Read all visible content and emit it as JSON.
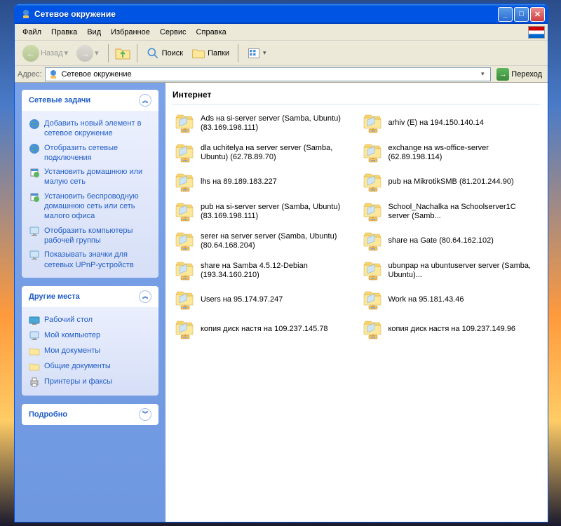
{
  "window": {
    "title": "Сетевое окружение"
  },
  "menubar": {
    "file": "Файл",
    "edit": "Правка",
    "view": "Вид",
    "favorites": "Избранное",
    "tools": "Сервис",
    "help": "Справка"
  },
  "toolbar": {
    "back": "Назад",
    "search": "Поиск",
    "folders": "Папки"
  },
  "addressbar": {
    "label": "Адрес:",
    "value": "Сетевое окружение",
    "go": "Переход"
  },
  "sidebar": {
    "panel1": {
      "title": "Сетевые задачи",
      "items": [
        "Добавить новый элемент в сетевое окружение",
        "Отобразить сетевые подключения",
        "Установить домашнюю или малую сеть",
        "Установить беспроводную домашнюю сеть или сеть малого офиса",
        "Отобразить компьютеры рабочей группы",
        "Показывать значки для сетевых UPnP-устройств"
      ]
    },
    "panel2": {
      "title": "Другие места",
      "items": [
        "Рабочий стол",
        "Мой компьютер",
        "Мои документы",
        "Общие документы",
        "Принтеры и факсы"
      ]
    },
    "panel3": {
      "title": "Подробно"
    }
  },
  "main": {
    "heading": "Интернет",
    "items": [
      "Ads на si-server server (Samba, Ubuntu) (83.169.198.111)",
      "arhiv (E) на 194.150.140.14",
      "dla uchitelya на server server (Samba, Ubuntu) (62.78.89.70)",
      "exchange на ws-office-server (62.89.198.114)",
      "lhs на 89.189.183.227",
      "pub на MikrotikSMB (81.201.244.90)",
      "pub на si-server server (Samba, Ubuntu) (83.169.198.111)",
      "School_Nachalka на Schoolserver1C server (Samb...",
      "serer на server server (Samba, Ubuntu) (80.64.168.204)",
      "share на Gate (80.64.162.102)",
      "share на Samba 4.5.12-Debian (193.34.160.210)",
      "ubunpap на ubuntuserver server (Samba, Ubuntu)...",
      "Users на 95.174.97.247",
      "Work на 95.181.43.46",
      "копия диск настя на 109.237.145.78",
      "копия диск настя на 109.237.149.96"
    ]
  }
}
